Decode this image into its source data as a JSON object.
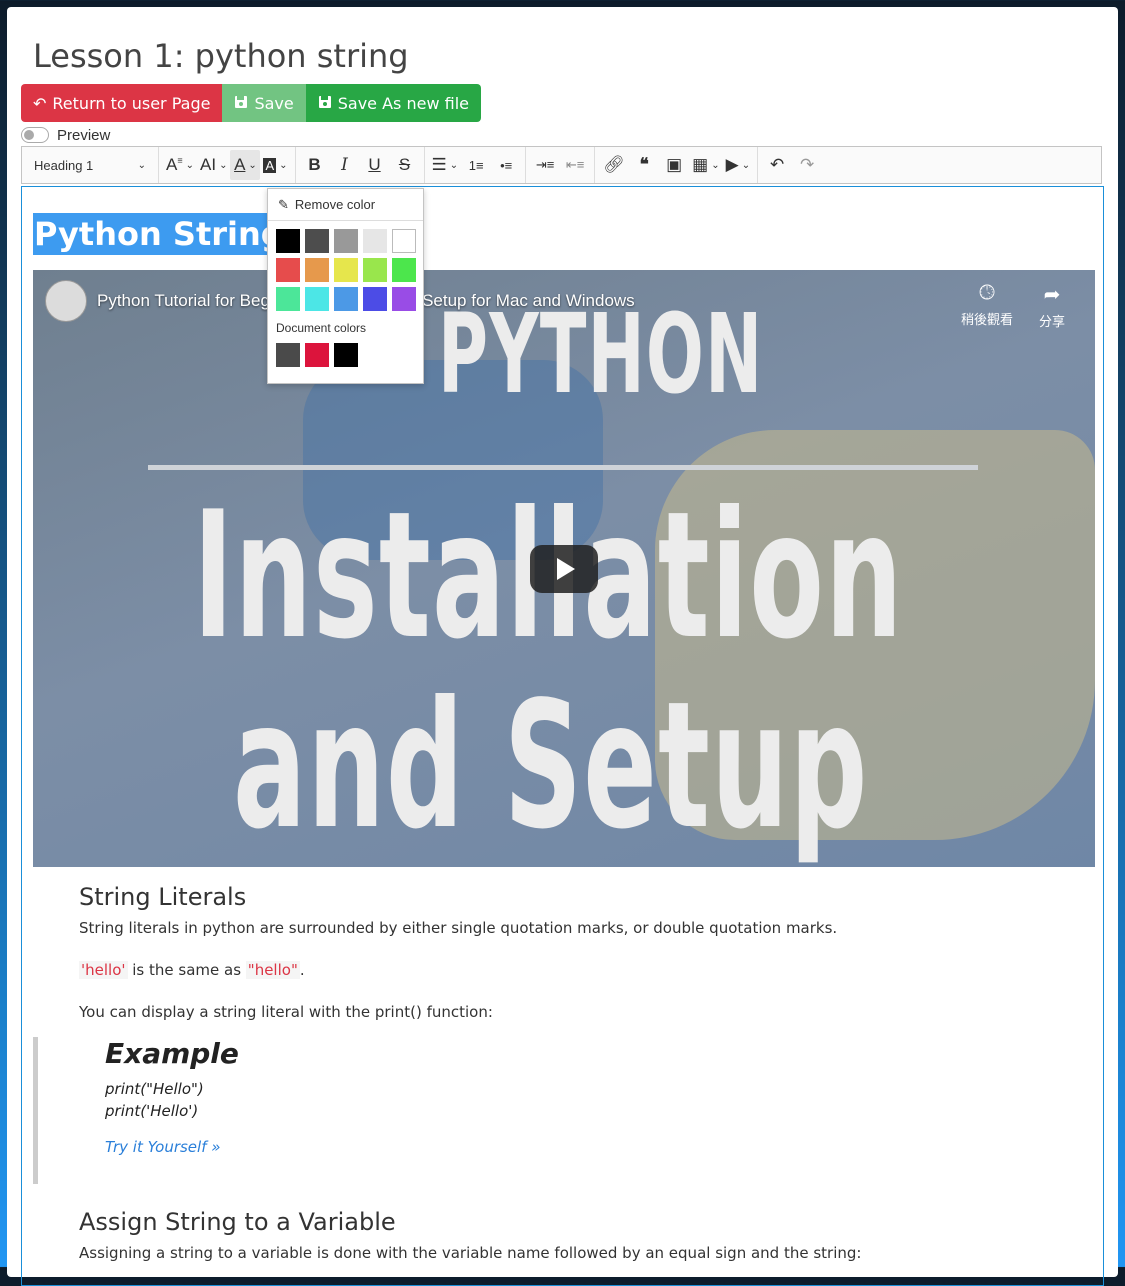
{
  "page": {
    "title": "Lesson 1: python string"
  },
  "buttons": {
    "return_label": "Return to user Page",
    "save_label": "Save",
    "save_as_label": "Save As new file"
  },
  "preview": {
    "label": "Preview",
    "enabled": false
  },
  "toolbar": {
    "heading_value": "Heading 1",
    "active_tool": "font-color"
  },
  "color_popup": {
    "remove_label": "Remove color",
    "colors": [
      "#000000",
      "#4d4d4d",
      "#999999",
      "#e6e6e6",
      "#ffffff",
      "#e64c4c",
      "#e6994c",
      "#e6e64c",
      "#99e64c",
      "#4ce64c",
      "#4ce699",
      "#4ce6e6",
      "#4c99e6",
      "#4c4ce6",
      "#994ce6"
    ],
    "doc_colors_label": "Document colors",
    "doc_colors": [
      "#4a4a4a",
      "#dc143c",
      "#000000"
    ]
  },
  "editor": {
    "heading": "Python Strings",
    "video": {
      "title": "Python Tutorial for Beginners 1: Install and Setup for Mac and Windows",
      "watch_later": "稍後觀看",
      "share": "分享",
      "big_line1": "PYTHON",
      "big_line2": "Installation",
      "big_line3": "and Setup"
    },
    "s1_heading": "String Literals",
    "s1_p1": "String literals in python are surrounded by either single quotation marks, or double quotation marks.",
    "s1_code1": "'hello'",
    "s1_mid": " is the same as ",
    "s1_code2": "\"hello\"",
    "s1_end": ".",
    "s1_p3": "You can display a string literal with the print() function:",
    "example_heading": "Example",
    "example_line1": "print(\"Hello\")",
    "example_line2": "print('Hello')",
    "try_link": "Try it Yourself »",
    "s2_heading": "Assign String to a Variable",
    "s2_p1": "Assigning a string to a variable is done with the variable name followed by an equal sign and the string:"
  }
}
